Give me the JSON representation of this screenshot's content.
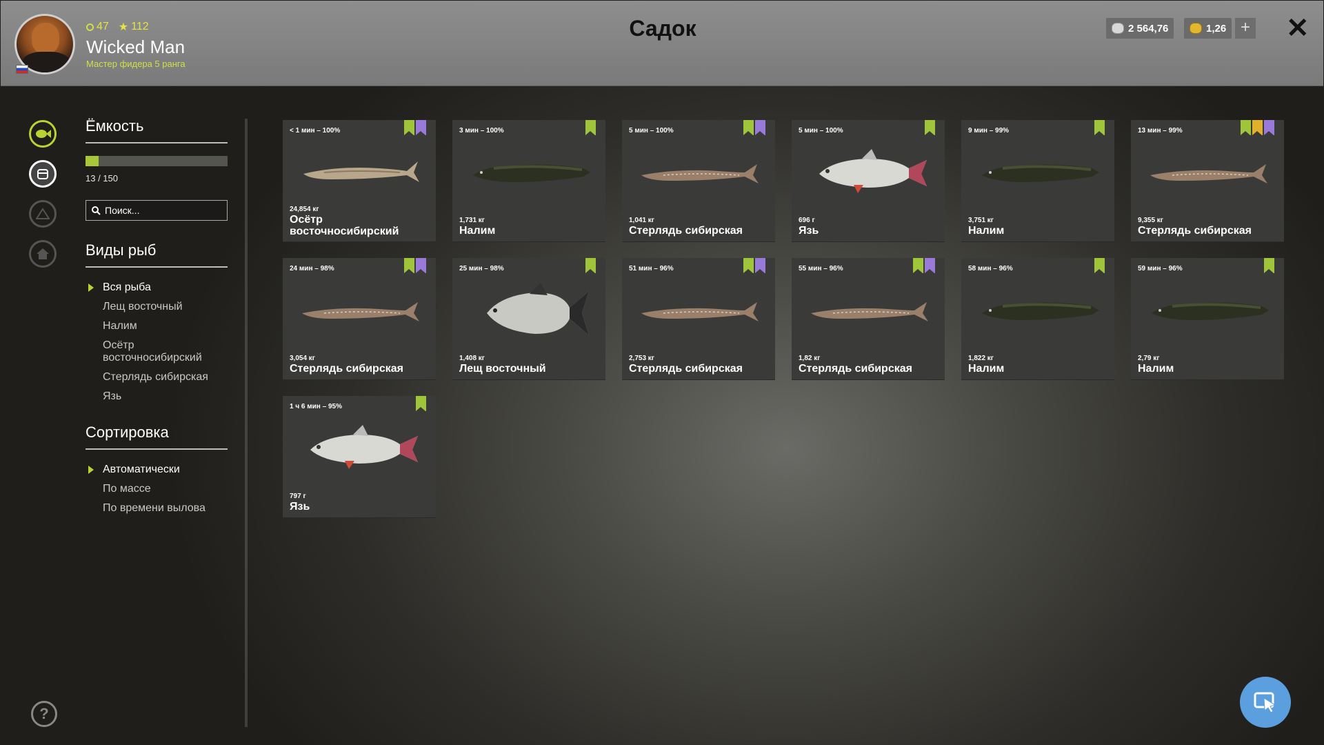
{
  "header": {
    "title": "Садок",
    "player": {
      "level": "47",
      "stars": "112",
      "name": "Wicked Man",
      "rank": "Мастер фидера 5 ранга"
    },
    "silver": "2 564,76",
    "gold": "1,26",
    "add_label": "+",
    "close_label": "✕"
  },
  "sidebar": {
    "capacity_title": "Ёмкость",
    "capacity_used": 13,
    "capacity_max": 150,
    "capacity_text": "13 / 150",
    "search_placeholder": "Поиск...",
    "species_title": "Виды рыб",
    "species": [
      "Вся рыба",
      "Лещ восточный",
      "Налим",
      "Осётр восточносибирский",
      "Стерлядь сибирская",
      "Язь"
    ],
    "sort_title": "Сортировка",
    "sort_options": [
      "Автоматически",
      "По массе",
      "По времени вылова"
    ],
    "help_label": "?"
  },
  "fish": [
    {
      "time": "< 1 мин – 100%",
      "weight": "24,854 кг",
      "name": "Осётр восточносибирский",
      "tags": [
        "green",
        "violet"
      ],
      "kind": "sturgeon"
    },
    {
      "time": "3 мин – 100%",
      "weight": "1,731 кг",
      "name": "Налим",
      "tags": [
        "green"
      ],
      "kind": "burbot"
    },
    {
      "time": "5 мин – 100%",
      "weight": "1,041 кг",
      "name": "Стерлядь сибирская",
      "tags": [
        "green",
        "violet"
      ],
      "kind": "sterlet"
    },
    {
      "time": "5 мин – 100%",
      "weight": "696 г",
      "name": "Язь",
      "tags": [
        "green"
      ],
      "kind": "ide"
    },
    {
      "time": "9 мин – 99%",
      "weight": "3,751 кг",
      "name": "Налим",
      "tags": [
        "green"
      ],
      "kind": "burbot"
    },
    {
      "time": "13 мин – 99%",
      "weight": "9,355 кг",
      "name": "Стерлядь сибирская",
      "tags": [
        "green",
        "gold",
        "violet"
      ],
      "kind": "sterlet"
    },
    {
      "time": "24 мин – 98%",
      "weight": "3,054 кг",
      "name": "Стерлядь сибирская",
      "tags": [
        "green",
        "violet"
      ],
      "kind": "sterlet"
    },
    {
      "time": "25 мин – 98%",
      "weight": "1,408 кг",
      "name": "Лещ восточный",
      "tags": [
        "green"
      ],
      "kind": "bream"
    },
    {
      "time": "51 мин – 96%",
      "weight": "2,753 кг",
      "name": "Стерлядь сибирская",
      "tags": [
        "green",
        "violet"
      ],
      "kind": "sterlet"
    },
    {
      "time": "55 мин – 96%",
      "weight": "1,82 кг",
      "name": "Стерлядь сибирская",
      "tags": [
        "green",
        "violet"
      ],
      "kind": "sterlet"
    },
    {
      "time": "58 мин – 96%",
      "weight": "1,822 кг",
      "name": "Налим",
      "tags": [
        "green"
      ],
      "kind": "burbot"
    },
    {
      "time": "59 мин – 96%",
      "weight": "2,79 кг",
      "name": "Налим",
      "tags": [
        "green"
      ],
      "kind": "burbot"
    },
    {
      "time": "1 ч 6 мин – 95%",
      "weight": "797 г",
      "name": "Язь",
      "tags": [
        "green"
      ],
      "kind": "ide"
    }
  ]
}
